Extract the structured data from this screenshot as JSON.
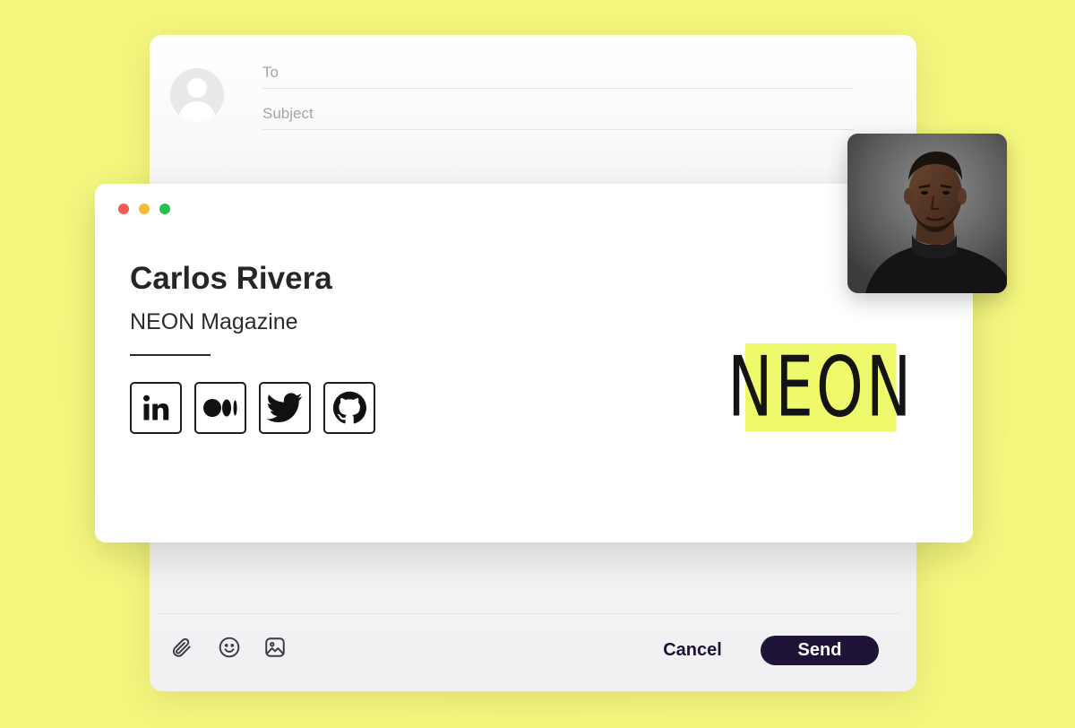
{
  "colors": {
    "background": "#f2f57a",
    "accent_dark": "#1f1337",
    "neon_yellow": "#eefa6b",
    "dot_red": "#f15b52",
    "dot_yellow": "#f6b93a",
    "dot_green": "#27c24c"
  },
  "compose": {
    "to_placeholder": "To",
    "subject_placeholder": "Subject",
    "toolbar": {
      "icons": [
        "paperclip-icon",
        "smiley-icon",
        "image-icon"
      ],
      "cancel_label": "Cancel",
      "send_label": "Send"
    }
  },
  "signature": {
    "name": "Carlos Rivera",
    "company": "NEON Magazine",
    "social_icons": [
      "linkedin-icon",
      "medium-icon",
      "twitter-icon",
      "github-icon"
    ],
    "logo_text": "NEON"
  },
  "profile_photo": {
    "icon": "profile-photo"
  }
}
